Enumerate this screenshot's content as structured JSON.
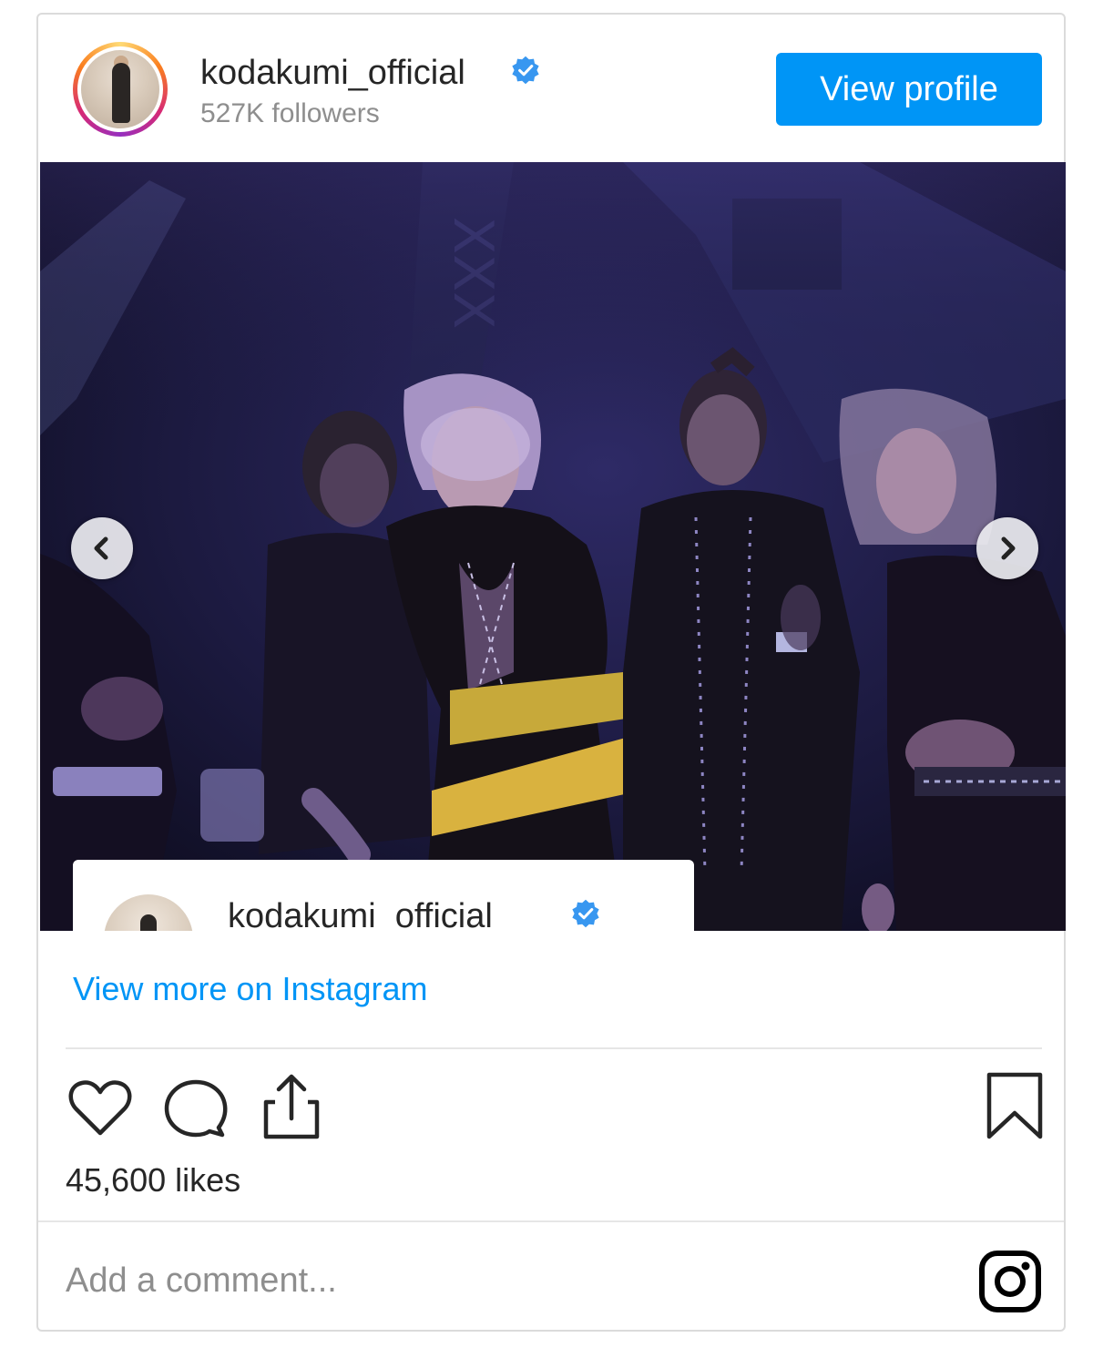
{
  "header": {
    "username": "kodakumi_official",
    "verified_icon": "verified-badge-icon",
    "followers": "527K followers",
    "view_profile_label": "View profile"
  },
  "media": {
    "prev_icon": "chevron-left-icon",
    "next_icon": "chevron-right-icon",
    "overlay_username": "kodakumi_official"
  },
  "links": {
    "view_more": "View more on Instagram"
  },
  "actions": {
    "like_icon": "heart-icon",
    "comment_icon": "comment-icon",
    "share_icon": "share-icon",
    "save_icon": "bookmark-icon"
  },
  "likes": "45,600 likes",
  "comment": {
    "placeholder": "Add a comment...",
    "value": ""
  },
  "footer": {
    "logo_icon": "instagram-logo-icon"
  },
  "colors": {
    "accent": "#0095f6",
    "text": "#262626",
    "muted": "#8e8e8e",
    "border": "#dbdbdb",
    "verified": "#3897f0"
  }
}
